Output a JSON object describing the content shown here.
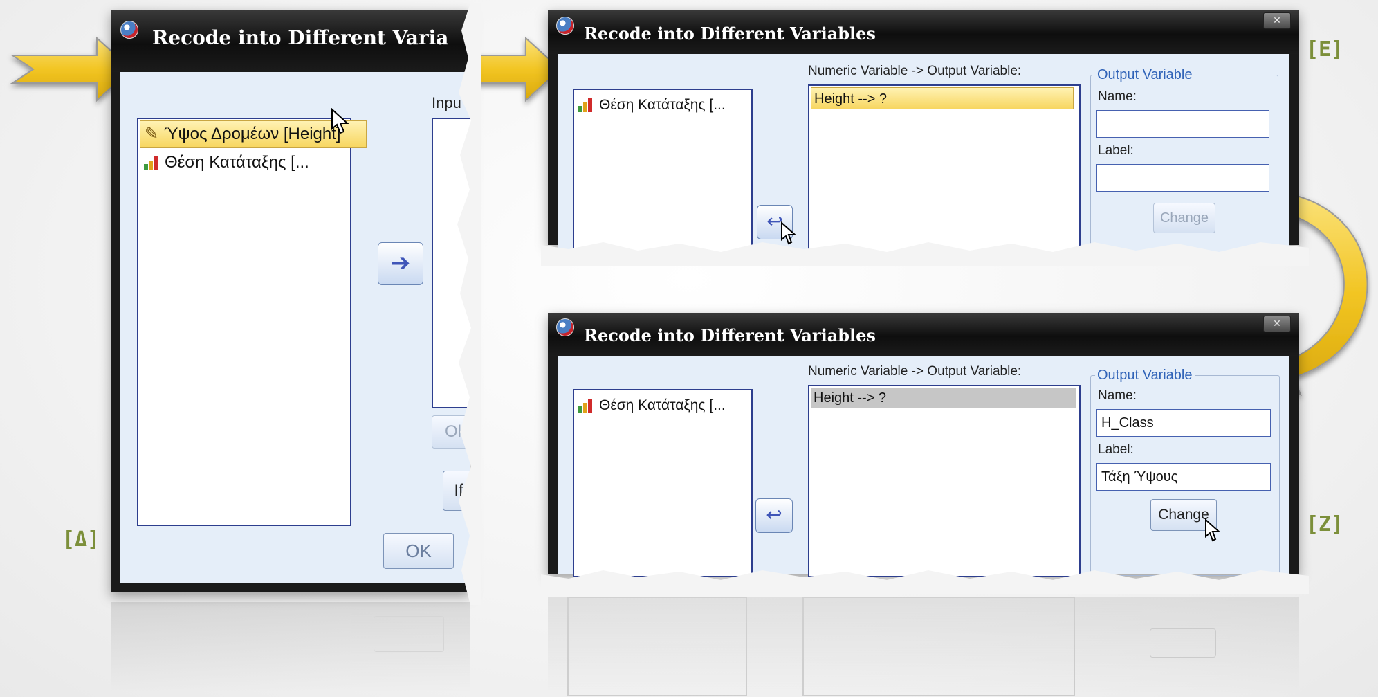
{
  "window_title": "Recode into Different Variables",
  "left_dialog": {
    "title_visible": "Recode into Different Varia",
    "variables": [
      "Ύψος Δρομέων [Height]",
      "Θέση Κατάταξης [..."
    ],
    "input_label_partial": "Inpu",
    "old_new_partial": "Ol",
    "if_partial": "If",
    "ok_label": "OK",
    "step_label": "[Δ]"
  },
  "top_right_dialog": {
    "variables": [
      "Θέση Κατάταξης [..."
    ],
    "numeric_header": "Numeric Variable -> Output Variable:",
    "mapping": "Height --> ?",
    "output_group": "Output Variable",
    "name_label": "Name:",
    "name_value": "",
    "label_label": "Label:",
    "label_value": "",
    "change_label": "Change",
    "step_label": "[E]"
  },
  "bottom_right_dialog": {
    "variables": [
      "Θέση Κατάταξης [..."
    ],
    "numeric_header": "Numeric Variable -> Output Variable:",
    "mapping": "Height --> ?",
    "output_group": "Output Variable",
    "name_label": "Name:",
    "name_value": "H_Class",
    "label_label": "Label:",
    "label_value": "Τάξη Ύψους",
    "change_label": "Change",
    "step_label": "[Z]"
  },
  "colors": {
    "arrow_yellow": "#f2c523",
    "tag_green": "#7c8f3a",
    "client_bg": "#e5eef9",
    "titlebar": "#111111"
  }
}
